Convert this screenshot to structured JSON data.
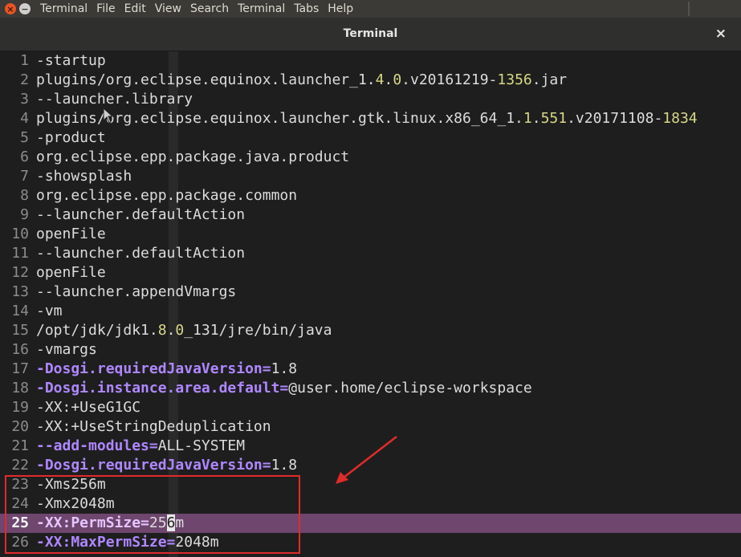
{
  "menubar": {
    "close_glyph": "×",
    "minimize_glyph": "−",
    "items": [
      "Terminal",
      "File",
      "Edit",
      "View",
      "Search",
      "Terminal",
      "Tabs",
      "Help"
    ]
  },
  "titlebar": {
    "title": "Terminal",
    "close_glyph": "×"
  },
  "editor": {
    "current_line": 25,
    "lines": [
      {
        "n": "1",
        "t": "-startup"
      },
      {
        "n": "2",
        "t": "plugins/org.eclipse.equinox.launcher_1.4.0.v20161219-1356.jar"
      },
      {
        "n": "3",
        "t": "--launcher.library"
      },
      {
        "n": "4",
        "t": "plugins/org.eclipse.equinox.launcher.gtk.linux.x86_64_1.1.551.v20171108-1834"
      },
      {
        "n": "5",
        "t": "-product"
      },
      {
        "n": "6",
        "t": "org.eclipse.epp.package.java.product"
      },
      {
        "n": "7",
        "t": "-showsplash"
      },
      {
        "n": "8",
        "t": "org.eclipse.epp.package.common"
      },
      {
        "n": "9",
        "t": "--launcher.defaultAction"
      },
      {
        "n": "10",
        "t": "openFile"
      },
      {
        "n": "11",
        "t": "--launcher.defaultAction"
      },
      {
        "n": "12",
        "t": "openFile"
      },
      {
        "n": "13",
        "t": "--launcher.appendVmargs"
      },
      {
        "n": "14",
        "t": "-vm"
      },
      {
        "n": "15",
        "t": "/opt/jdk/jdk1.8.0_131/jre/bin/java"
      },
      {
        "n": "16",
        "t": "-vmargs"
      },
      {
        "n": "17",
        "t": "-Dosgi.requiredJavaVersion=1.8"
      },
      {
        "n": "18",
        "t": "-Dosgi.instance.area.default=@user.home/eclipse-workspace"
      },
      {
        "n": "19",
        "t": "-XX:+UseG1GC"
      },
      {
        "n": "20",
        "t": "-XX:+UseStringDeduplication"
      },
      {
        "n": "21",
        "t": "--add-modules=ALL-SYSTEM"
      },
      {
        "n": "22",
        "t": "-Dosgi.requiredJavaVersion=1.8"
      },
      {
        "n": "23",
        "t": "-Xms256m"
      },
      {
        "n": "24",
        "t": "-Xmx2048m"
      },
      {
        "n": "25",
        "t": "-XX:PermSize=256m"
      },
      {
        "n": "26",
        "t": "-XX:MaxPermSize=2048m"
      }
    ]
  },
  "colors": {
    "background": "#1e1e1e",
    "current_line": "#6e466e",
    "option_keyword": "#af87ff",
    "number": "#d7d787",
    "annotation": "#e02b2b"
  }
}
